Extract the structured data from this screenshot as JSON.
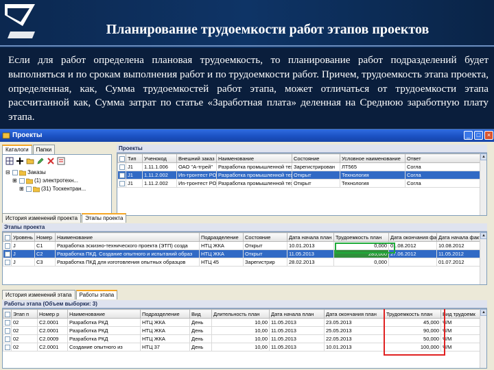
{
  "slide": {
    "title": "Планирование трудоемкости работ этапов проектов",
    "body": "Если для работ определена плановая трудоемкость, то планирование работ подразделений будет выполняться и по срокам выполнения работ и по трудоемкости работ. Причем, трудоемкость этапа проекта, определенная, как, Сумма трудоемкостей работ этапа, может отличаться от трудоемкости этапа рассчитанной как, Сумма затрат по статье «Заработная плата» деленная на Среднюю заработную плату этапа."
  },
  "window": {
    "title": "Проекты"
  },
  "left_panel": {
    "tabs": [
      "Каталоги",
      "Папки"
    ],
    "tree": [
      "Заказы",
      "(1) электротехн...",
      "(31) Тоскентран..."
    ]
  },
  "projects": {
    "tab": "Проекты",
    "columns": [
      "Тип",
      "Ученокод",
      "Внешний заказ",
      "Наименование",
      "Состояние",
      "Условное наименование",
      "Ответ"
    ],
    "rows": [
      [
        "J1",
        "1.11.1.006",
        "ОАО \"А-тгрей\"",
        "Разработка промышленной технолог",
        "Зарегистрирован",
        "ЛТ565",
        "Согла"
      ],
      [
        "J1",
        "1.11.2.002",
        "Иn-тронтест РО",
        "Разработка промышленной технолог",
        "Открыт",
        "Технология",
        "Согла"
      ],
      [
        "J1",
        "1.11.2.002",
        "Иn-тронтест РО",
        "Разработка промышленной технолог",
        "Открыт",
        "Технология",
        "Согла"
      ]
    ],
    "selected_row": 1
  },
  "stages": {
    "tabs": [
      "История изменений проекта",
      "Этапы проекта"
    ],
    "section": "Этапы проекта",
    "columns": [
      "Уровень",
      "Номер",
      "Наименование",
      "Подразделение",
      "Состояние",
      "Дата начала план",
      "Трудоемкость план",
      "Дата окончания факт",
      "Дата начала факт"
    ],
    "rows": [
      [
        "J",
        "C1",
        "Разработка эскизно-технического проекта (ЭТП) созда",
        "НТЦ ЖКА",
        "Открыт",
        "10.01.2013",
        "0,000",
        "01.08.2012",
        "10.08.2012"
      ],
      [
        "J",
        "C2",
        "Разработка ПКД. Создание опытного и испытаний образ",
        "НТЦ ЖКА",
        "Открыт",
        "11.05.2013",
        "285,000",
        "27.06.2012",
        "11.05.2012"
      ],
      [
        "J",
        "C3",
        "Разработка ПКД для изготовления опытных образцов",
        "НТЦ 45",
        "Зарегистрир",
        "28.02.2013",
        "0,000",
        "",
        "01.07.2012"
      ]
    ],
    "selected_row": 1
  },
  "works": {
    "tabs": [
      "История изменений этапа",
      "Работы этапа"
    ],
    "section": "Работы этапа (Объем выборки: 3)",
    "columns": [
      "Этап п",
      "Номер р",
      "Наименование",
      "Подразделение",
      "Вид",
      "Длительность план",
      "Дата начала план",
      "Дата окончания план",
      "Трудоемкость план",
      "Вид трудоемк"
    ],
    "rows": [
      [
        "02",
        "C2.0001",
        "Разработка РКД",
        "НТЦ ЖКА",
        "День",
        "10,00",
        "11.05.2013",
        "23.05.2013",
        "45,000",
        "Ч/М"
      ],
      [
        "02",
        "C2.0001",
        "Разработка РКД",
        "НТЦ ЖКА",
        "День",
        "10,00",
        "11.05.2013",
        "25.05.2013",
        "90,000",
        "Ч/М"
      ],
      [
        "02",
        "C2.0009",
        "Разработка РКД",
        "НТЦ ЖКА",
        "День",
        "10,00",
        "11.05.2013",
        "22.05.2013",
        "50,000",
        "Ч/М"
      ],
      [
        "02",
        "C2.0001",
        "Создание опытного из",
        "НТЦ 37",
        "День",
        "10,00",
        "11.05.2013",
        "10.01.2013",
        "100,000",
        "Ч/М"
      ]
    ]
  }
}
